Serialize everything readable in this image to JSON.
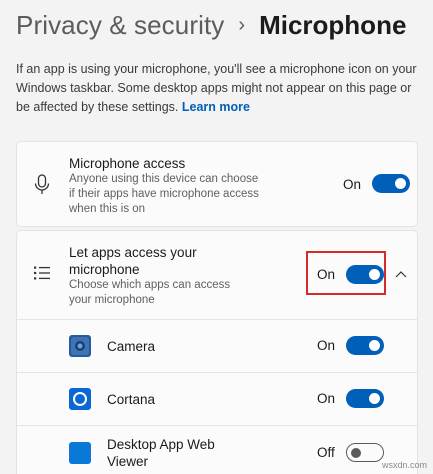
{
  "breadcrumb": {
    "parent": "Privacy & security",
    "separator": "›",
    "current": "Microphone"
  },
  "description": {
    "text": "If an app is using your microphone, you'll see a microphone icon on your Windows taskbar. Some desktop apps might not appear on this page or be affected by these settings.",
    "link": "Learn more"
  },
  "microphone_access": {
    "title": "Microphone access",
    "subtitle_line1": "Anyone using this device can choose",
    "subtitle_line2": "if their apps have microphone access",
    "subtitle_line3": "when this is on",
    "state_label": "On",
    "toggle_on": true,
    "icon": "microphone-icon"
  },
  "let_apps_access": {
    "title_line1": "Let apps access your",
    "title_line2": "microphone",
    "subtitle_line1": "Choose which apps can access",
    "subtitle_line2": "your microphone",
    "state_label": "On",
    "toggle_on": true,
    "icon": "list-icon",
    "expand_icon": "chevron-up-icon"
  },
  "apps": [
    {
      "name": "Camera",
      "state_label": "On",
      "toggle_on": true,
      "icon": "camera-app-icon"
    },
    {
      "name": "Cortana",
      "state_label": "On",
      "toggle_on": true,
      "icon": "cortana-app-icon"
    },
    {
      "name_line1": "Desktop App Web",
      "name_line2": "Viewer",
      "state_label": "Off",
      "toggle_on": false,
      "icon": "webview-app-icon"
    }
  ],
  "colors": {
    "accent": "#005fb8",
    "highlight": "#d42a2a",
    "background": "#f3f3f3",
    "card": "#fbfbfb"
  },
  "watermark": "wsxdn.com"
}
